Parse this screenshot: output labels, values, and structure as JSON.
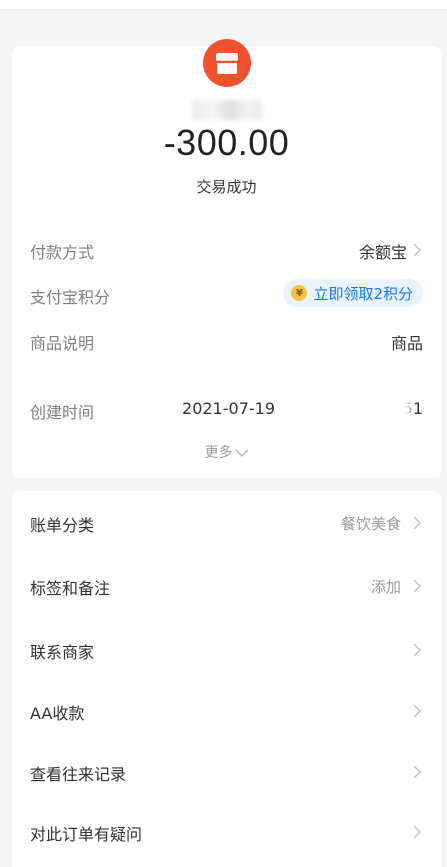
{
  "transaction": {
    "amount": "-300.00",
    "status": "交易成功"
  },
  "details": {
    "payment_method_label": "付款方式",
    "payment_method_value": "余额宝",
    "points_label": "支付宝积分",
    "points_action": "立即领取2积分",
    "description_label": "商品说明",
    "description_value": "商品",
    "created_label": "创建时间",
    "created_value_start": "2021-07-19",
    "created_value_end": "51",
    "more_label": "更多"
  },
  "actions": [
    {
      "label": "账单分类",
      "value": "餐饮美食"
    },
    {
      "label": "标签和备注",
      "value": "添加"
    },
    {
      "label": "联系商家",
      "value": ""
    },
    {
      "label": "AA收款",
      "value": ""
    },
    {
      "label": "查看往来记录",
      "value": ""
    },
    {
      "label": "对此订单有疑问",
      "value": ""
    }
  ],
  "colors": {
    "merchant_icon": "#f0522d",
    "points_pill_bg": "#eaf4ff",
    "points_text": "#1677ff",
    "coin": "#f5c243"
  },
  "icons": {
    "merchant": "storefront-icon",
    "chevron": "chevron-right-icon",
    "more": "chevron-down-icon",
    "coin": "coin-icon"
  }
}
